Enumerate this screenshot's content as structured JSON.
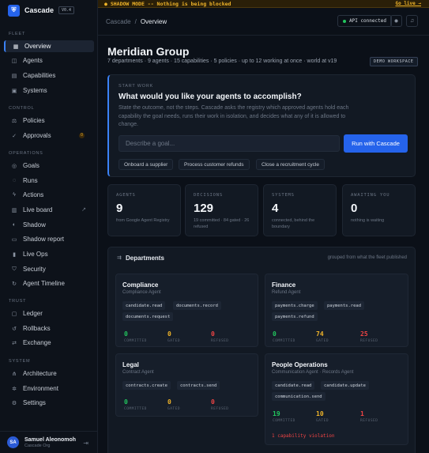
{
  "brand": {
    "logo": "⛨",
    "name": "Cascade",
    "version": "V0.4"
  },
  "banner": {
    "text": "SHADOW MODE -- Nothing is being blocked",
    "link": "Go live →"
  },
  "breadcrumb": {
    "root": "Cascade",
    "sep": "/",
    "current": "Overview"
  },
  "topbar": {
    "api_status": "API connected",
    "status_color": "#22c55e"
  },
  "sidebar": {
    "sections": {
      "fleet": "FLEET",
      "control": "CONTROL",
      "operations": "OPERATIONS",
      "trust": "TRUST",
      "system": "SYSTEM"
    },
    "items": {
      "overview": {
        "label": "Overview",
        "icon": "grid-icon"
      },
      "agents": {
        "label": "Agents",
        "icon": "agents-icon"
      },
      "capabilities": {
        "label": "Capabilities",
        "icon": "bolt-icon"
      },
      "systems": {
        "label": "Systems",
        "icon": "server-icon"
      },
      "policies": {
        "label": "Policies",
        "icon": "scale-icon"
      },
      "approvals": {
        "label": "Approvals",
        "icon": "check-icon",
        "badge": "0"
      },
      "goals": {
        "label": "Goals",
        "icon": "target-icon"
      },
      "runs": {
        "label": "Runs",
        "icon": "play-icon"
      },
      "actions": {
        "label": "Actions",
        "icon": "lightning-icon"
      },
      "liveboard": {
        "label": "Live board",
        "icon": "board-icon"
      },
      "shadow": {
        "label": "Shadow",
        "icon": "eye-icon"
      },
      "shadowreport": {
        "label": "Shadow report",
        "icon": "report-icon"
      },
      "liveops": {
        "label": "Live Ops",
        "icon": "chart-icon"
      },
      "security": {
        "label": "Security",
        "icon": "shield-icon"
      },
      "timeline": {
        "label": "Agent Timeline",
        "icon": "timeline-icon"
      },
      "ledger": {
        "label": "Ledger",
        "icon": "ledger-icon"
      },
      "rollbacks": {
        "label": "Rollbacks",
        "icon": "undo-icon"
      },
      "exchange": {
        "label": "Exchange",
        "icon": "exchange-icon"
      },
      "architecture": {
        "label": "Architecture",
        "icon": "architecture-icon"
      },
      "environment": {
        "label": "Environment",
        "icon": "environment-icon"
      },
      "settings": {
        "label": "Settings",
        "icon": "gear-icon"
      }
    }
  },
  "user": {
    "initials": "SA",
    "name": "Samuel Aleonomoh",
    "org": "Cascade Org"
  },
  "header": {
    "title": "Meridian Group",
    "subtitle": "7 departments · 9 agents · 15 capabilities · 5 policies · up to 12 working at once · world at v19",
    "badge": "DEMO WORKSPACE"
  },
  "start_work": {
    "label": "START WORK",
    "question": "What would you like your agents to accomplish?",
    "description": "State the outcome, not the steps. Cascade asks the registry which approved agents hold each capability the goal needs, runs their work in isolation, and decides what any of it is allowed to change.",
    "placeholder": "Describe a goal...",
    "run_label": "Run with Cascade",
    "suggestions": [
      "Onboard a supplier",
      "Process customer refunds",
      "Close a recruitment cycle"
    ]
  },
  "stats": [
    {
      "label": "AGENTS",
      "value": "9",
      "sub": "from Google Agent Registry"
    },
    {
      "label": "DECISIONS",
      "value": "129",
      "sub": "19 committed · 84 gated · 26 refused"
    },
    {
      "label": "SYSTEMS",
      "value": "4",
      "sub": "connected, behind the boundary"
    },
    {
      "label": "AWAITING YOU",
      "value": "0",
      "sub": "nothing is waiting"
    }
  ],
  "departments": {
    "title": "Departments",
    "note": "grouped from what the fleet published",
    "count_labels": {
      "committed": "COMMITTED",
      "gated": "GATED",
      "refused": "REFUSED"
    },
    "items": [
      {
        "name": "Compliance",
        "agent": "Compliance Agent",
        "caps": [
          "candidate.read",
          "documents.record",
          "documents.request"
        ],
        "committed": "0",
        "gated": "0",
        "refused": "0"
      },
      {
        "name": "Finance",
        "agent": "Refund Agent",
        "caps": [
          "payments.charge",
          "payments.read",
          "payments.refund"
        ],
        "committed": "0",
        "gated": "74",
        "refused": "25"
      },
      {
        "name": "Legal",
        "agent": "Contract Agent",
        "caps": [
          "contracts.create",
          "contracts.send"
        ],
        "committed": "0",
        "gated": "0",
        "refused": "0"
      },
      {
        "name": "People Operations",
        "agent": "Communication Agent · Records Agent",
        "caps": [
          "candidate.read",
          "candidate.update",
          "communication.send"
        ],
        "committed": "19",
        "gated": "10",
        "refused": "1",
        "violation": "1 capability violation"
      }
    ]
  }
}
